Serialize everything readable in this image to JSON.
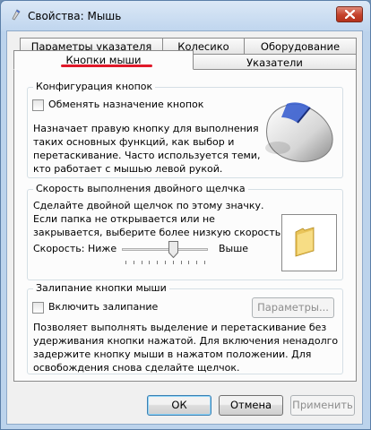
{
  "window": {
    "title": "Свойства: Мышь"
  },
  "tabs": {
    "row1": [
      {
        "label": "Параметры указателя"
      },
      {
        "label": "Колесико"
      },
      {
        "label": "Оборудование"
      }
    ],
    "row2": [
      {
        "label": "Кнопки мыши"
      },
      {
        "label": "Указатели"
      }
    ]
  },
  "button_config": {
    "title": "Конфигурация кнопок",
    "checkbox_label": "Обменять назначение кнопок",
    "checked": false,
    "desc_lines": [
      "Назначает правую кнопку для выполнения",
      "таких основных функций, как выбор и",
      "перетаскивание. Часто используется теми,",
      "кто работает с мышью левой рукой."
    ]
  },
  "double_click": {
    "title": "Скорость выполнения двойного щелчка",
    "desc_lines": [
      "Сделайте двойной щелчок по этому значку.",
      "Если папка не открывается или не",
      "закрывается, выберите более низкую скорость."
    ],
    "speed_label": "Скорость:",
    "slow_label": "Ниже",
    "fast_label": "Выше",
    "speed_level": 0.6
  },
  "click_lock": {
    "title": "Залипание кнопки мыши",
    "checkbox_label": "Включить залипание",
    "checked": false,
    "settings_label": "Параметры...",
    "desc_lines": [
      "Позволяет выполнять выделение и перетаскивание без",
      "удерживания кнопки нажатой. Для включения ненадолго",
      "задержите кнопку мыши в нажатом положении. Для",
      "освобождения снова сделайте щелчок."
    ]
  },
  "footer": {
    "ok_label": "ОК",
    "cancel_label": "Отмена",
    "apply_label": "Применить"
  }
}
